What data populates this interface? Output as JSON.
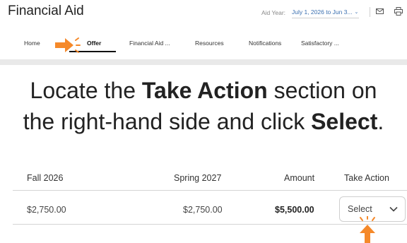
{
  "header": {
    "title": "Financial Aid",
    "aid_year_label": "Aid Year:",
    "aid_year_value": "July 1, 2026 to Jun 3...",
    "icons": [
      "mail-icon",
      "print-icon",
      "chevron-down-icon"
    ]
  },
  "nav": {
    "tabs": [
      {
        "label": "Home"
      },
      {
        "label": "Offer",
        "active": true
      },
      {
        "label": "Financial Aid ..."
      },
      {
        "label": "Resources"
      },
      {
        "label": "Notifications"
      },
      {
        "label": "Satisfactory ..."
      }
    ]
  },
  "instruction": {
    "part1": "Locate the ",
    "bold1": "Take Action",
    "part2": " section on",
    "part3": "the right-hand side and click ",
    "bold2": "Select",
    "part4": "."
  },
  "table": {
    "headers": [
      "Fall 2026",
      "Spring 2027",
      "Amount",
      "Take Action"
    ],
    "row": {
      "fall": "$2,750.00",
      "spring": "$2,750.00",
      "amount": "$5,500.00",
      "action_label": "Select"
    }
  },
  "colors": {
    "accent_arrow": "#f5892a",
    "link_blue": "#3a6fb0",
    "band_gray": "#e9e9e9"
  }
}
